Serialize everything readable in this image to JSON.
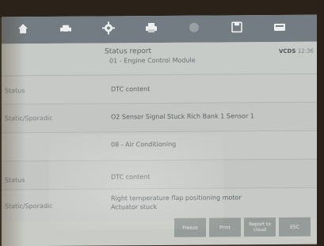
{
  "toolbar": {
    "buttons": [
      {
        "icon": "home-icon"
      },
      {
        "icon": "car-icon"
      },
      {
        "icon": "gear-icon"
      },
      {
        "icon": "print-icon"
      },
      {
        "icon": "help-icon"
      },
      {
        "icon": "save-icon"
      },
      {
        "icon": "screen-icon"
      }
    ]
  },
  "header": {
    "title": "Status report",
    "subtitle": "01 - Engine Control Module",
    "brand": "VCDS",
    "brand_sub": "12:36"
  },
  "rows": [
    {
      "label": "Status",
      "value": "DTC content"
    },
    {
      "label": "Static/Sporadic",
      "value": "O2 Sensor Signal Stuck Rich  Bank 1 Sensor 1"
    },
    {
      "label": "",
      "value": "08 - Air Conditioning"
    },
    {
      "label": "Status",
      "value": "DTC content"
    },
    {
      "label": "Static/Sporadic",
      "value": "Right temperature flap positioning motor\nActuator stuck"
    }
  ],
  "footer": {
    "buttons": [
      "Freeze",
      "Print",
      "Report to\ncloud",
      "ESC"
    ]
  }
}
